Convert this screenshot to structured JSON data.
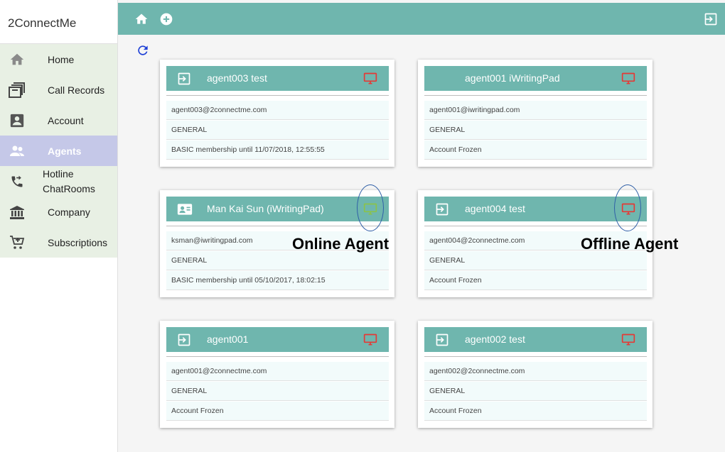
{
  "app": {
    "brand": "2ConnectMe"
  },
  "sidebar": {
    "items": [
      {
        "label": "Home",
        "icon": "home-icon"
      },
      {
        "label": "Call Records",
        "icon": "archive-icon"
      },
      {
        "label": "Account",
        "icon": "account-box-icon"
      },
      {
        "label": "Agents",
        "icon": "people-icon",
        "active": true
      },
      {
        "label": "Hotline ChatRooms",
        "line1": "Hotline",
        "line2": "ChatRooms",
        "icon": "phone-forward-icon"
      },
      {
        "label": "Company",
        "icon": "bank-icon"
      },
      {
        "label": "Subscriptions",
        "icon": "cart-add-icon"
      }
    ]
  },
  "topbar": {
    "icons": [
      "home-icon",
      "add-circle-icon",
      "logout-icon"
    ]
  },
  "colors": {
    "accent": "#6fb6ae",
    "online": "#8bc34a",
    "offline": "#e53935",
    "active_nav": "#c5c8e8",
    "nav_bg": "#e8f0e4"
  },
  "agents": [
    {
      "name": "agent003 test",
      "email": "agent003@2connectme.com",
      "group": "GENERAL",
      "status": "BASIC membership until 11/07/2018, 12:55:55",
      "left_icon": "login-icon",
      "monitor": "offline"
    },
    {
      "name": "agent001 iWritingPad",
      "email": "agent001@iwritingpad.com",
      "group": "GENERAL",
      "status": "Account Frozen",
      "left_icon": "",
      "monitor": "offline"
    },
    {
      "name": "Man Kai Sun (iWritingPad)",
      "email": "ksman@iwritingpad.com",
      "group": "GENERAL",
      "status": "BASIC membership until 05/10/2017, 18:02:15",
      "left_icon": "contact-card-icon",
      "monitor": "online"
    },
    {
      "name": "agent004 test",
      "email": "agent004@2connectme.com",
      "group": "GENERAL",
      "status": "Account Frozen",
      "left_icon": "login-icon",
      "monitor": "offline"
    },
    {
      "name": "agent001",
      "email": "agent001@2connectme.com",
      "group": "GENERAL",
      "status": "Account Frozen",
      "left_icon": "login-icon",
      "monitor": "offline"
    },
    {
      "name": "agent002 test",
      "email": "agent002@2connectme.com",
      "group": "GENERAL",
      "status": "Account Frozen",
      "left_icon": "login-icon",
      "monitor": "offline"
    }
  ],
  "annotations": {
    "online": "Online Agent",
    "offline": "Offline Agent"
  }
}
